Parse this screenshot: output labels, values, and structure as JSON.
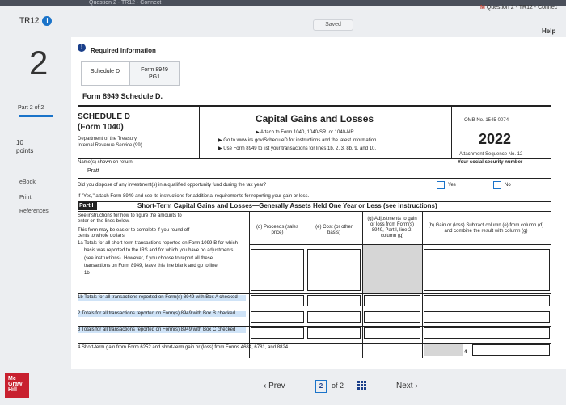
{
  "window": {
    "title": "Question 2 - TR12 - Connect",
    "app_short": "Connect"
  },
  "header": {
    "assignment": "TR12",
    "saved_label": "Saved",
    "help_label": "Help",
    "question_line": "Question 2 - TR12 - Connec",
    "m_badge": "M"
  },
  "sidebar": {
    "question_number": "2",
    "part_label": "Part 2 of 2",
    "points_value": "10",
    "points_label": "points",
    "links": [
      "eBook",
      "Print",
      "References"
    ],
    "logo_text": [
      "Mc",
      "Graw",
      "Hill"
    ]
  },
  "panel": {
    "required_label": "Required information",
    "tabs": [
      {
        "label": "Schedule D"
      },
      {
        "label_line1": "Form 8949",
        "label_line2": "PG1"
      }
    ],
    "form_title": "Form 8949 Schedule D."
  },
  "form": {
    "schedule_l1": "SCHEDULE D",
    "schedule_l2": "(Form 1040)",
    "dept_l1": "Department of the Treasury",
    "dept_l2": "Internal Revenue Service (99)",
    "main_title": "Capital Gains and Losses",
    "attach1": "▶ Attach to Form 1040, 1040-SR, or 1040-NR.",
    "attach2": "▶ Go to www.irs.gov/ScheduleD for instructions and the latest information.",
    "attach3": "▶ Use Form 8949 to list your transactions for lines 1b, 2, 3, 8b, 9, and 10.",
    "omb": "OMB No. 1545-0074",
    "year": "2022",
    "sequence": "Attachment Sequence No. 12",
    "ssn_label": "Your social security number",
    "name_label": "Name(s) shown on return",
    "name_value": "Pratt",
    "qoz_question": "Did you dispose of any investment(s) in a qualified opportunity fund during the tax year?",
    "yes_label": "Yes",
    "no_label": "No",
    "yes_attach": "If \"Yes,\" attach Form 8949 and see its instructions for additional requirements for reporting your gain or loss.",
    "part_label": "Part I",
    "part_title": "Short-Term Capital Gains and Losses—Generally Assets Held One Year or Less (see instructions)",
    "instr1": "See instructions for how to figure the amounts to enter on the lines below.",
    "instr2": "This form may be easier to complete if you round off cents to whole dollars.",
    "col_d": "(d) Proceeds (sales price)",
    "col_e": "(e) Cost (or other basis)",
    "col_g": "(g) Adjustments to gain or loss from Form(s) 8949, Part I, line 2, column (g)",
    "col_h": "(h) Gain or (loss) Subtract column (e) from column (d) and combine the result with column (g)",
    "line1a_1": "1a Totals for all short-term transactions reported on Form 1099-B for which",
    "line1a_2": "basis was reported to the IRS and for which you have no adjustments",
    "line1a_3": "(see instructions). However, if you choose to report all these",
    "line1a_4": "transactions on Form 8949, leave this line blank and go to line",
    "line1a_5": "1b",
    "line1b": "1b Totals for all transactions reported on Form(s) 8949 with Box A checked",
    "line2": "2 Totals for all transactions reported on Form(s) 8949 with Box B checked",
    "line3": "3 Totals for all transactions reported on Form(s) 8949 with Box C checked",
    "line4": "4 Short-term gain from Form 6252 and short-term gain or (loss) from Forms 4684, 6781, and 8824",
    "line4_num": "4"
  },
  "pager": {
    "prev_label": "Prev",
    "current": "2",
    "of_label": "of 2",
    "next_label": "Next"
  }
}
